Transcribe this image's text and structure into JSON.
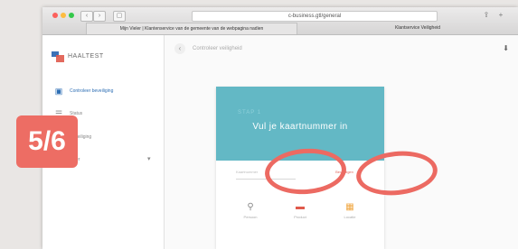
{
  "browser": {
    "address": "c-business.gtl/general",
    "tabs": [
      {
        "label": "Mijn Vieler | Klantenservice van de gemeente van de webpagina nadien"
      },
      {
        "label": "Klantservice Veiligheid"
      }
    ],
    "controls": {
      "back": "‹",
      "forward": "›",
      "tabs_icon": "▢",
      "share": "⇪",
      "plus": "+"
    }
  },
  "sidebar": {
    "brand": "HAALTEST",
    "items": [
      {
        "label": "Controleer beveiliging",
        "icon": "lock-icon",
        "glyph": "▣",
        "active": true
      },
      {
        "label": "Status",
        "icon": "list-icon",
        "glyph": "☰",
        "active": false
      },
      {
        "label": "Beveiliging",
        "icon": "shield-icon",
        "glyph": "◇",
        "active": false
      },
      {
        "label": "Meer",
        "icon": "more-icon",
        "glyph": "",
        "active": false
      }
    ],
    "expand_glyph": "▾"
  },
  "topbar": {
    "title": "Controleer veiligheid",
    "back_glyph": "‹",
    "download_glyph": "⬇"
  },
  "card": {
    "step": "STAP 1",
    "title": "Vul je kaartnummer in",
    "input_placeholder": "Kaartnummer",
    "confirm_label": "Bevestigen",
    "options": [
      {
        "label": "Persoon",
        "icon": "person-icon",
        "glyph": "⚲",
        "color": "#8a8a8a"
      },
      {
        "label": "Product",
        "icon": "card-icon",
        "glyph": "▬",
        "color": "#e05a4c"
      },
      {
        "label": "Locatie",
        "icon": "gift-icon",
        "glyph": "▦",
        "color": "#f0a640"
      }
    ]
  },
  "badge": {
    "text": "5/6"
  },
  "colors": {
    "accent": "#63b8c5",
    "annotation": "#ec6a62",
    "active_link": "#2d6eb4"
  }
}
